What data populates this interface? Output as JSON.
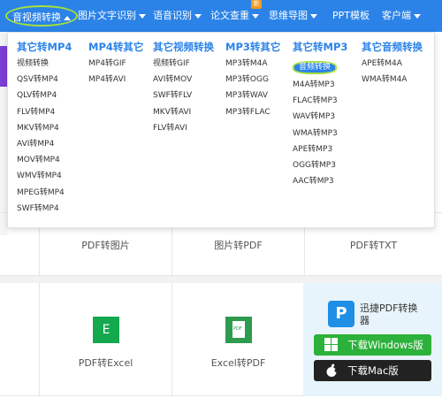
{
  "nav": {
    "items": [
      {
        "label": "音视频转换",
        "active": true
      },
      {
        "label": "图片文字识别"
      },
      {
        "label": "语音识别"
      },
      {
        "label": "论文查重",
        "badge": "新"
      },
      {
        "label": "思维导图"
      },
      {
        "label": "PPT模板"
      },
      {
        "label": "客户端"
      }
    ]
  },
  "dropdown": {
    "columns": [
      {
        "heading": "其它转MP4",
        "items": [
          "视频转换",
          "QSV转MP4",
          "QLV转MP4",
          "FLV转MP4",
          "MKV转MP4",
          "AVI转MP4",
          "MOV转MP4",
          "WMV转MP4",
          "MPEG转MP4",
          "SWF转MP4"
        ]
      },
      {
        "heading": "MP4转其它",
        "items": [
          "MP4转GIF",
          "MP4转AVI"
        ]
      },
      {
        "heading": "其它视频转换",
        "items": [
          "视频转GIF",
          "AVI转MOV",
          "SWF转FLV",
          "MKV转AVI",
          "FLV转AVI"
        ]
      },
      {
        "heading": "MP3转其它",
        "items": [
          "MP3转M4A",
          "MP3转OGG",
          "MP3转WAV",
          "MP3转FLAC"
        ]
      },
      {
        "heading": "其它转MP3",
        "items": [
          "音频转换",
          "M4A转MP3",
          "FLAC转MP3",
          "WAV转MP3",
          "WMA转MP3",
          "APE转MP3",
          "OGG转MP3",
          "AAC转MP3"
        ]
      },
      {
        "heading": "其它音频转换",
        "items": [
          "APE转M4A",
          "WMA转M4A"
        ]
      }
    ]
  },
  "grid": {
    "row1": [
      "PDF转图片",
      "图片转PDF",
      "PDF转TXT"
    ],
    "row2": [
      "PDF转Excel",
      "Excel转PDF"
    ],
    "excel_icon_letter": "E",
    "pdf_icon_text": "PDF"
  },
  "promo": {
    "title": "迅捷PDF转换器",
    "logo_letter": "P",
    "windows_button": "下载Windows版",
    "mac_button": "下载Mac版"
  },
  "colors": {
    "nav_bg": "#2b83e8",
    "heading": "#2b83e8",
    "highlight_ring": "#a6e03a",
    "badge": "#f39a1f",
    "win_button": "#2cb13a",
    "mac_button": "#222222"
  }
}
